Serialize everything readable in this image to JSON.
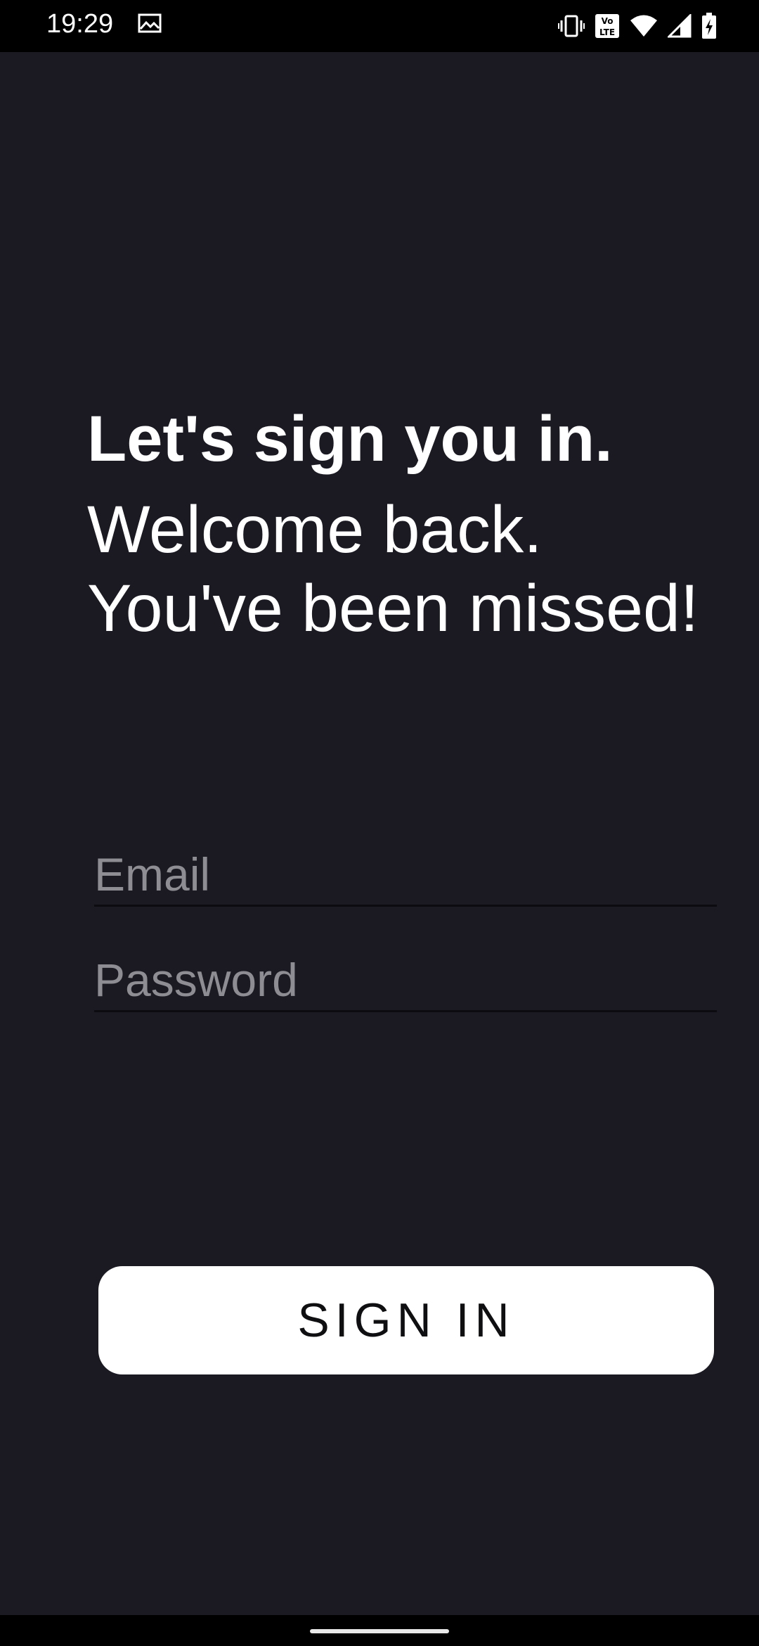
{
  "status_bar": {
    "time": "19:29",
    "left_icon": "image-icon",
    "right_icons": [
      "vibrate-icon",
      "volte-icon",
      "wifi-icon",
      "signal-icon",
      "battery-charging-icon"
    ]
  },
  "login": {
    "title": "Let's sign you in.",
    "subtitle_line1": "Welcome back.",
    "subtitle_line2": "You've been missed!",
    "email": {
      "placeholder": "Email",
      "value": ""
    },
    "password": {
      "placeholder": "Password",
      "value": ""
    },
    "sign_in_label": "SIGN IN"
  },
  "colors": {
    "background": "#1b1a23",
    "button": "#ffffff",
    "placeholder": "#8e8d93"
  }
}
